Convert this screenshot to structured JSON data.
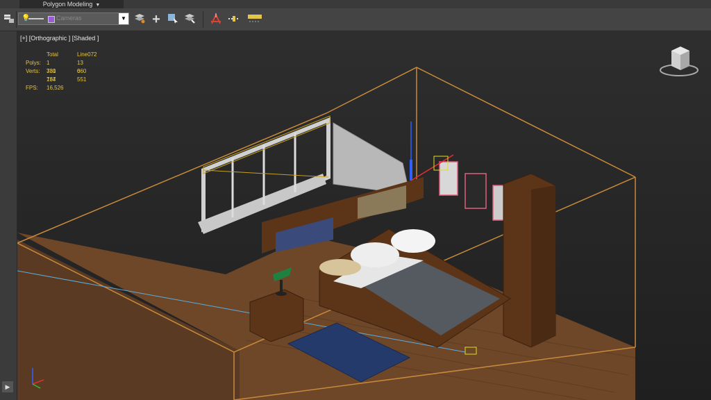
{
  "ribbon": {
    "tab_label": "Polygon Modeling"
  },
  "toolbar": {
    "selection_dropdown": {
      "value": "Cameras"
    }
  },
  "viewport": {
    "label": "[+] [Orthographic ] [Shaded ]",
    "stats": {
      "header_total": "Total",
      "header_object": "Line072",
      "polys_label": "Polys:",
      "polys_total": "1 330 764",
      "polys_object": "13 060",
      "verts_label": "Verts:",
      "verts_total": "781 137",
      "verts_object": "6 551",
      "fps_label": "FPS:",
      "fps_value": "16,526"
    }
  },
  "colors": {
    "stats_text": "#e3c548",
    "selection_wire": "#c8a020",
    "bounding_box": "#c88a3c",
    "floor": "#7a5230",
    "furniture": "#5c3418"
  },
  "icons": [
    "layer-explorer-icon",
    "bulb-icon",
    "layers-icon",
    "plus-icon",
    "select-icon",
    "layer-add-icon",
    "array-icon",
    "tape-icon",
    "ruler-icon",
    "viewcube-icon",
    "axis-tripod-icon",
    "play-icon"
  ]
}
